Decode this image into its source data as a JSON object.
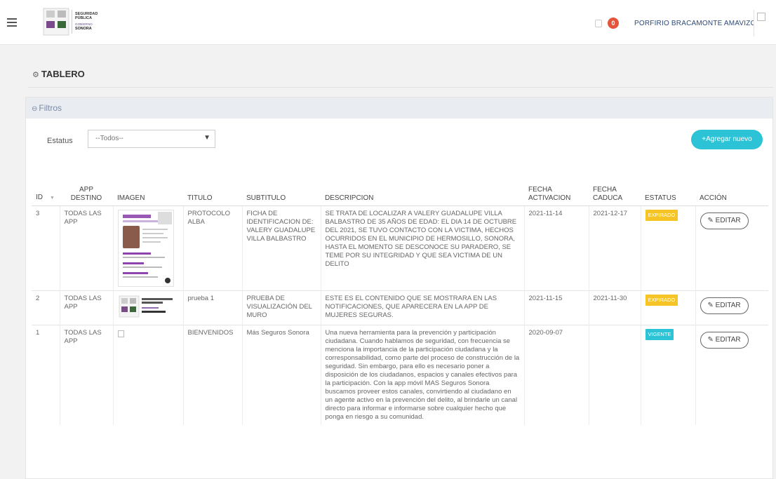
{
  "header": {
    "username": "PORFIRIO BRACAMONTE AMAVIZCA",
    "notification_count": "0",
    "logo_line1": "SEGURIDAD",
    "logo_line2": "PÚBLICA",
    "logo_line3": "GOBIERNO",
    "logo_line4": "SONORA"
  },
  "page": {
    "title": "TABLERO"
  },
  "filters": {
    "title": "Filtros",
    "status_label": "Estatus",
    "status_selected": "--Todos--",
    "add_button": "+Agregar nuevo"
  },
  "table": {
    "columns": [
      "ID",
      "APP DESTINO",
      "IMAGEN",
      "TITULO",
      "SUBTITULO",
      "DESCRIPCION",
      "FECHA ACTIVACION",
      "FECHA CADUCA",
      "ESTATUS",
      "ACCIÓN"
    ],
    "edit_label": "EDITAR",
    "rows": [
      {
        "id": "3",
        "app": "TODAS LAS APP",
        "titulo": "PROTOCOLO ALBA",
        "subtitulo": "FICHA DE IDENTIFICACION DE: VALERY GUADALUPE VILLA BALBASTRO",
        "descripcion": "SE TRATA DE LOCALIZAR A VALERY GUADALUPE VILLA BALBASTRO DE 35 AÑOS DE EDAD: EL DIA 14 DE OCTUBRE DEL 2021, SE TUVO CONTACTO CON LA VICTIMA, HECHOS OCURRIDOS EN EL MUNICIPIO DE HERMOSILLO, SONORA, HASTA EL MOMENTO SE DESCONOCE SU PARADERO, SE TEME POR SU INTEGRIDAD Y QUE SEA VICTIMA DE UN DELITO",
        "activacion": "2021-11-14",
        "caduca": "2021-12-17",
        "estatus": "EXPIRADO"
      },
      {
        "id": "2",
        "app": "TODAS LAS APP",
        "titulo": "prueba 1",
        "subtitulo": "PRUEBA DE VISUALIZACIÓN DEL MURO",
        "descripcion": "ESTE ES EL CONTENIDO QUE SE MOSTRARA EN LAS NOTIFICACIONES, QUE APARECERA EN LA APP DE MUJERES SEGURAS.",
        "activacion": "2021-11-15",
        "caduca": "2021-11-30",
        "estatus": "EXPIRADO"
      },
      {
        "id": "1",
        "app": "TODAS LAS APP",
        "titulo": "BIENVENIDOS",
        "subtitulo": "Más Seguros Sonora",
        "descripcion": "Una nueva herramienta para la prevención y participación ciudadana. Cuando hablamos de seguridad, con frecuencia se menciona la importancia de la participación ciudadana y la corresponsabilidad, como parte del proceso de construcción de la seguridad. Sin embargo, para ello es necesario poner a disposición de los ciudadanos, espacios y canales efectivos para la participación. Con la app móvil MAS Seguros Sonora buscamos proveer estos canales, convirtiendo al ciudadano en un agente activo en la prevención del delito, al brindarle un canal directo para informar e informarse sobre cualquier hecho que ponga en riesgo a su comunidad.",
        "activacion": "2020-09-07",
        "caduca": "",
        "estatus": "VIGENTE"
      }
    ]
  },
  "colors": {
    "accent": "#2cc3d6",
    "expired": "#f6c525",
    "vigente": "#2cc3d6",
    "notification": "#e5553c"
  }
}
